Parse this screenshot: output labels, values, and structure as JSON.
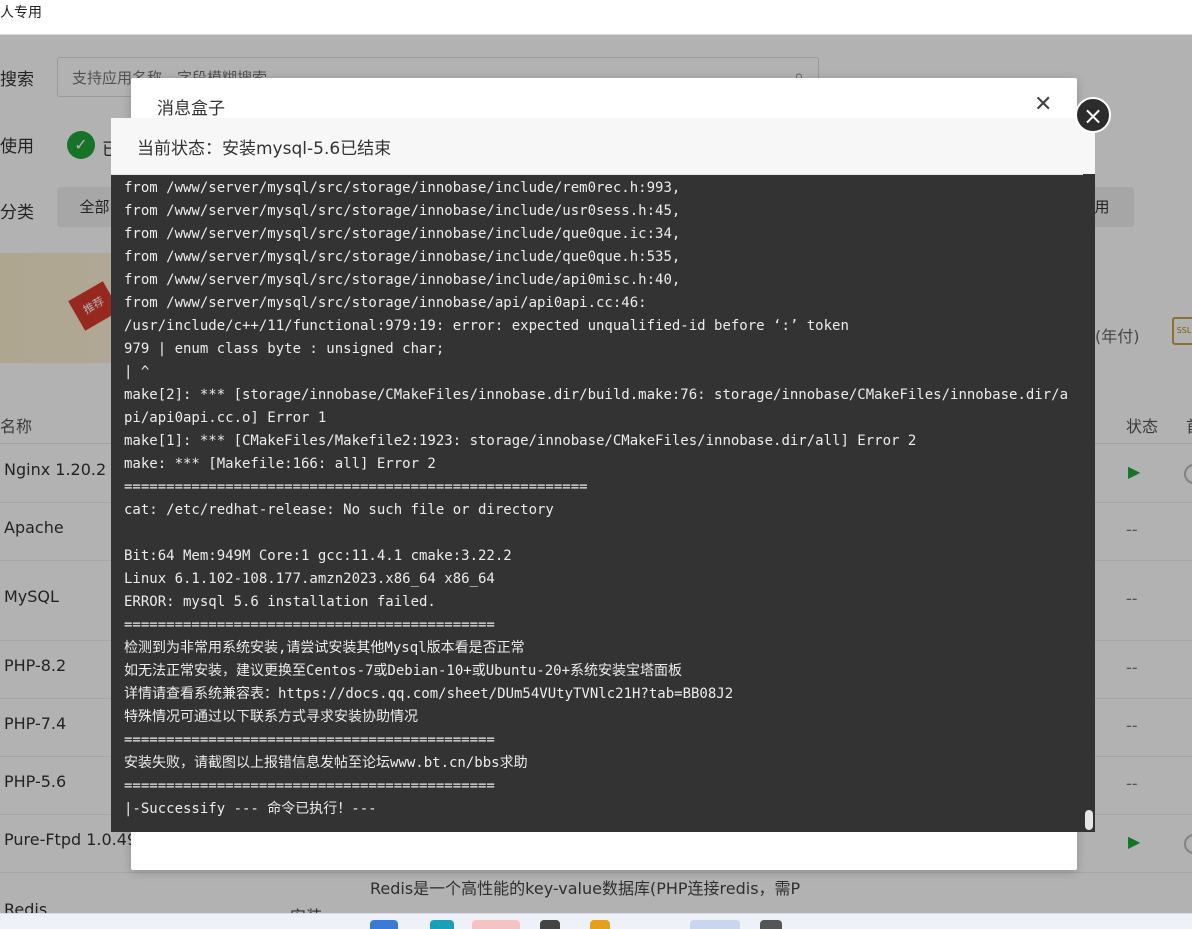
{
  "topbar": {
    "title": "人专用"
  },
  "toolbar": {
    "search_label": "搜索",
    "search_placeholder": "支持应用名称、字段模糊搜索",
    "installed_label": "使用",
    "installed_check_label": "已",
    "category_label": "分类",
    "category_all": "全部",
    "category_right": "用"
  },
  "banner": {
    "badge": "推荐",
    "yearly": "(年付)",
    "ssl": "SSL"
  },
  "table": {
    "headers": {
      "name": "名称",
      "col_status": "状态",
      "col_first": "首"
    },
    "rows": [
      {
        "name": "Nginx 1.20.2",
        "status": ""
      },
      {
        "name": "Apache",
        "status": "--"
      },
      {
        "name": "MySQL",
        "status": "--"
      },
      {
        "name": "PHP-8.2",
        "status": "--"
      },
      {
        "name": "PHP-7.4",
        "status": "--"
      },
      {
        "name": "PHP-5.6",
        "status": "--"
      },
      {
        "name": "Pure-Ftpd 1.0.49",
        "status": ""
      },
      {
        "name": "Redis",
        "status": ""
      }
    ],
    "redis_desc": "Redis是一个高性能的key-value数据库(PHP连接redis，需P",
    "redis_desc2": "安装"
  },
  "msgbox": {
    "title": "消息盒子"
  },
  "dialog": {
    "status": "当前状态：安装mysql-5.6已结束",
    "log": [
      "from /www/server/mysql/src/storage/innobase/include/rem0rec.h:993,",
      "from /www/server/mysql/src/storage/innobase/include/usr0sess.h:45,",
      "from /www/server/mysql/src/storage/innobase/include/que0que.ic:34,",
      "from /www/server/mysql/src/storage/innobase/include/que0que.h:535,",
      "from /www/server/mysql/src/storage/innobase/include/api0misc.h:40,",
      "from /www/server/mysql/src/storage/innobase/api/api0api.cc:46:",
      "/usr/include/c++/11/functional:979:19: error: expected unqualified-id before ‘:’ token",
      "979 | enum class byte : unsigned char;",
      "| ^",
      "make[2]: *** [storage/innobase/CMakeFiles/innobase.dir/build.make:76: storage/innobase/CMakeFiles/innobase.dir/api/api0api.cc.o] Error 1",
      "make[1]: *** [CMakeFiles/Makefile2:1923: storage/innobase/CMakeFiles/innobase.dir/all] Error 2",
      "make: *** [Makefile:166: all] Error 2",
      "=======================================================",
      "cat: /etc/redhat-release: No such file or directory",
      "",
      "Bit:64 Mem:949M Core:1 gcc:11.4.1 cmake:3.22.2",
      "Linux 6.1.102-108.177.amzn2023.x86_64 x86_64",
      "ERROR: mysql 5.6 installation failed.",
      "============================================",
      "检测到为非常用系统安装,请尝试安装其他Mysql版本看是否正常",
      "如无法正常安装，建议更换至Centos-7或Debian-10+或Ubuntu-20+系统安装宝塔面板",
      "详情请查看系统兼容表：https://docs.qq.com/sheet/DUm54VUtyTVNlc21H?tab=BB08J2",
      "特殊情况可通过以下联系方式寻求安装协助情况",
      "============================================",
      "安装失败，请截图以上报错信息发帖至论坛www.bt.cn/bbs求助",
      "============================================",
      "|-Successify --- 命令已执行！---"
    ]
  },
  "icons": {
    "search": "search-icon",
    "check": "check-circle-icon",
    "close": "close-icon",
    "play": "play-icon"
  },
  "colors": {
    "accent": "#20a53a",
    "terminal_bg": "#333333",
    "terminal_fg": "#ececec"
  }
}
